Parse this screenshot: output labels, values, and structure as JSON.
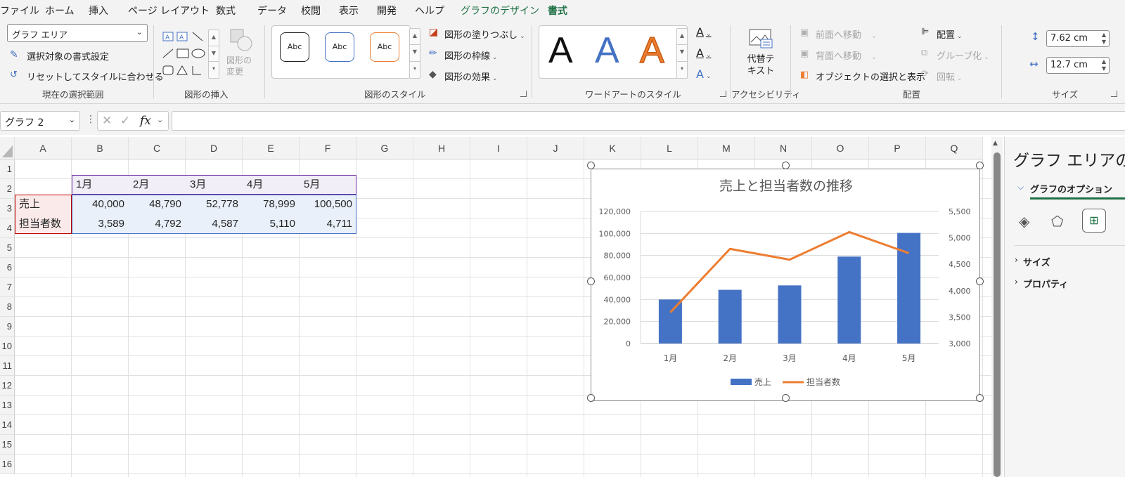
{
  "menu": {
    "tabs": [
      {
        "label": "ファイル"
      },
      {
        "label": "ホーム"
      },
      {
        "label": "挿入"
      },
      {
        "label": "ページ レイアウト"
      },
      {
        "label": "数式"
      },
      {
        "label": "データ"
      },
      {
        "label": "校閲"
      },
      {
        "label": "表示"
      },
      {
        "label": "開発"
      },
      {
        "label": "ヘルプ"
      },
      {
        "label": "グラフのデザイン"
      },
      {
        "label": "書式"
      }
    ],
    "active_tab": "書式",
    "accent_color": "#1e7145"
  },
  "ribbon": {
    "selection_group": {
      "dropdown_value": "グラフ エリア",
      "format_selection": "選択対象の書式設定",
      "reset_style": "リセットしてスタイルに合わせる",
      "label": "現在の選択範囲"
    },
    "insert_shapes_group": {
      "change_shape": "図形の変更",
      "label": "図形の挿入"
    },
    "shape_styles_group": {
      "style_samples": [
        "Abc",
        "Abc",
        "Abc"
      ],
      "fill": "図形の塗りつぶし",
      "outline": "図形の枠線",
      "effects": "図形の効果",
      "label": "図形のスタイル"
    },
    "wordart_group": {
      "letters": [
        "A",
        "A",
        "A"
      ],
      "label": "ワードアートのスタイル"
    },
    "accessibility_group": {
      "alt_text": "代替テキスト",
      "label": "アクセシビリティ"
    },
    "arrange_group": {
      "bring_forward": "前面へ移動",
      "send_backward": "背面へ移動",
      "selection_pane": "オブジェクトの選択と表示",
      "align": "配置",
      "group": "グループ化",
      "rotate": "回転",
      "label": "配置"
    },
    "size_group": {
      "height": "7.62 cm",
      "width": "12.7 cm",
      "label": "サイズ"
    }
  },
  "formula_bar": {
    "name_box": "グラフ 2",
    "fx": "fx",
    "content": ""
  },
  "sheet": {
    "columns": [
      "A",
      "B",
      "C",
      "D",
      "E",
      "F",
      "G",
      "H",
      "I",
      "J",
      "K",
      "L",
      "M",
      "N",
      "O",
      "P",
      "Q"
    ],
    "rows": [
      "1",
      "2",
      "3",
      "4",
      "5",
      "6",
      "7",
      "8",
      "9",
      "10",
      "11",
      "12",
      "13",
      "14",
      "15",
      "16"
    ],
    "table": {
      "header": [
        "1月",
        "2月",
        "3月",
        "4月",
        "5月"
      ],
      "rows": [
        {
          "label": "売上",
          "values": [
            "40,000",
            "48,790",
            "52,778",
            "78,999",
            "100,500"
          ]
        },
        {
          "label": "担当者数",
          "values": [
            "3,589",
            "4,792",
            "4,587",
            "5,110",
            "4,711"
          ]
        }
      ]
    }
  },
  "chart_data": {
    "type": "bar",
    "title": "売上と担当者数の推移",
    "categories": [
      "1月",
      "2月",
      "3月",
      "4月",
      "5月"
    ],
    "series": [
      {
        "name": "売上",
        "type": "bar",
        "axis": "left",
        "values": [
          40000,
          48790,
          52778,
          78999,
          100500
        ],
        "color": "#4472c4"
      },
      {
        "name": "担当者数",
        "type": "line",
        "axis": "right",
        "values": [
          3589,
          4792,
          4587,
          5110,
          4711
        ],
        "color": "#ed7d31"
      }
    ],
    "y_left": {
      "min": 0,
      "max": 120000,
      "step": 20000,
      "tick_labels": [
        "0",
        "20,000",
        "40,000",
        "60,000",
        "80,000",
        "100,000",
        "120,000"
      ]
    },
    "y_right": {
      "min": 3000,
      "max": 5500,
      "step": 500,
      "tick_labels": [
        "3,000",
        "3,500",
        "4,000",
        "4,500",
        "5,000",
        "5,500"
      ]
    },
    "grid": true,
    "legend": "bottom"
  },
  "format_pane": {
    "title": "グラフ エリアの書式設定",
    "tab": "グラフのオプション",
    "sections": [
      "サイズ",
      "プロパティ"
    ]
  }
}
